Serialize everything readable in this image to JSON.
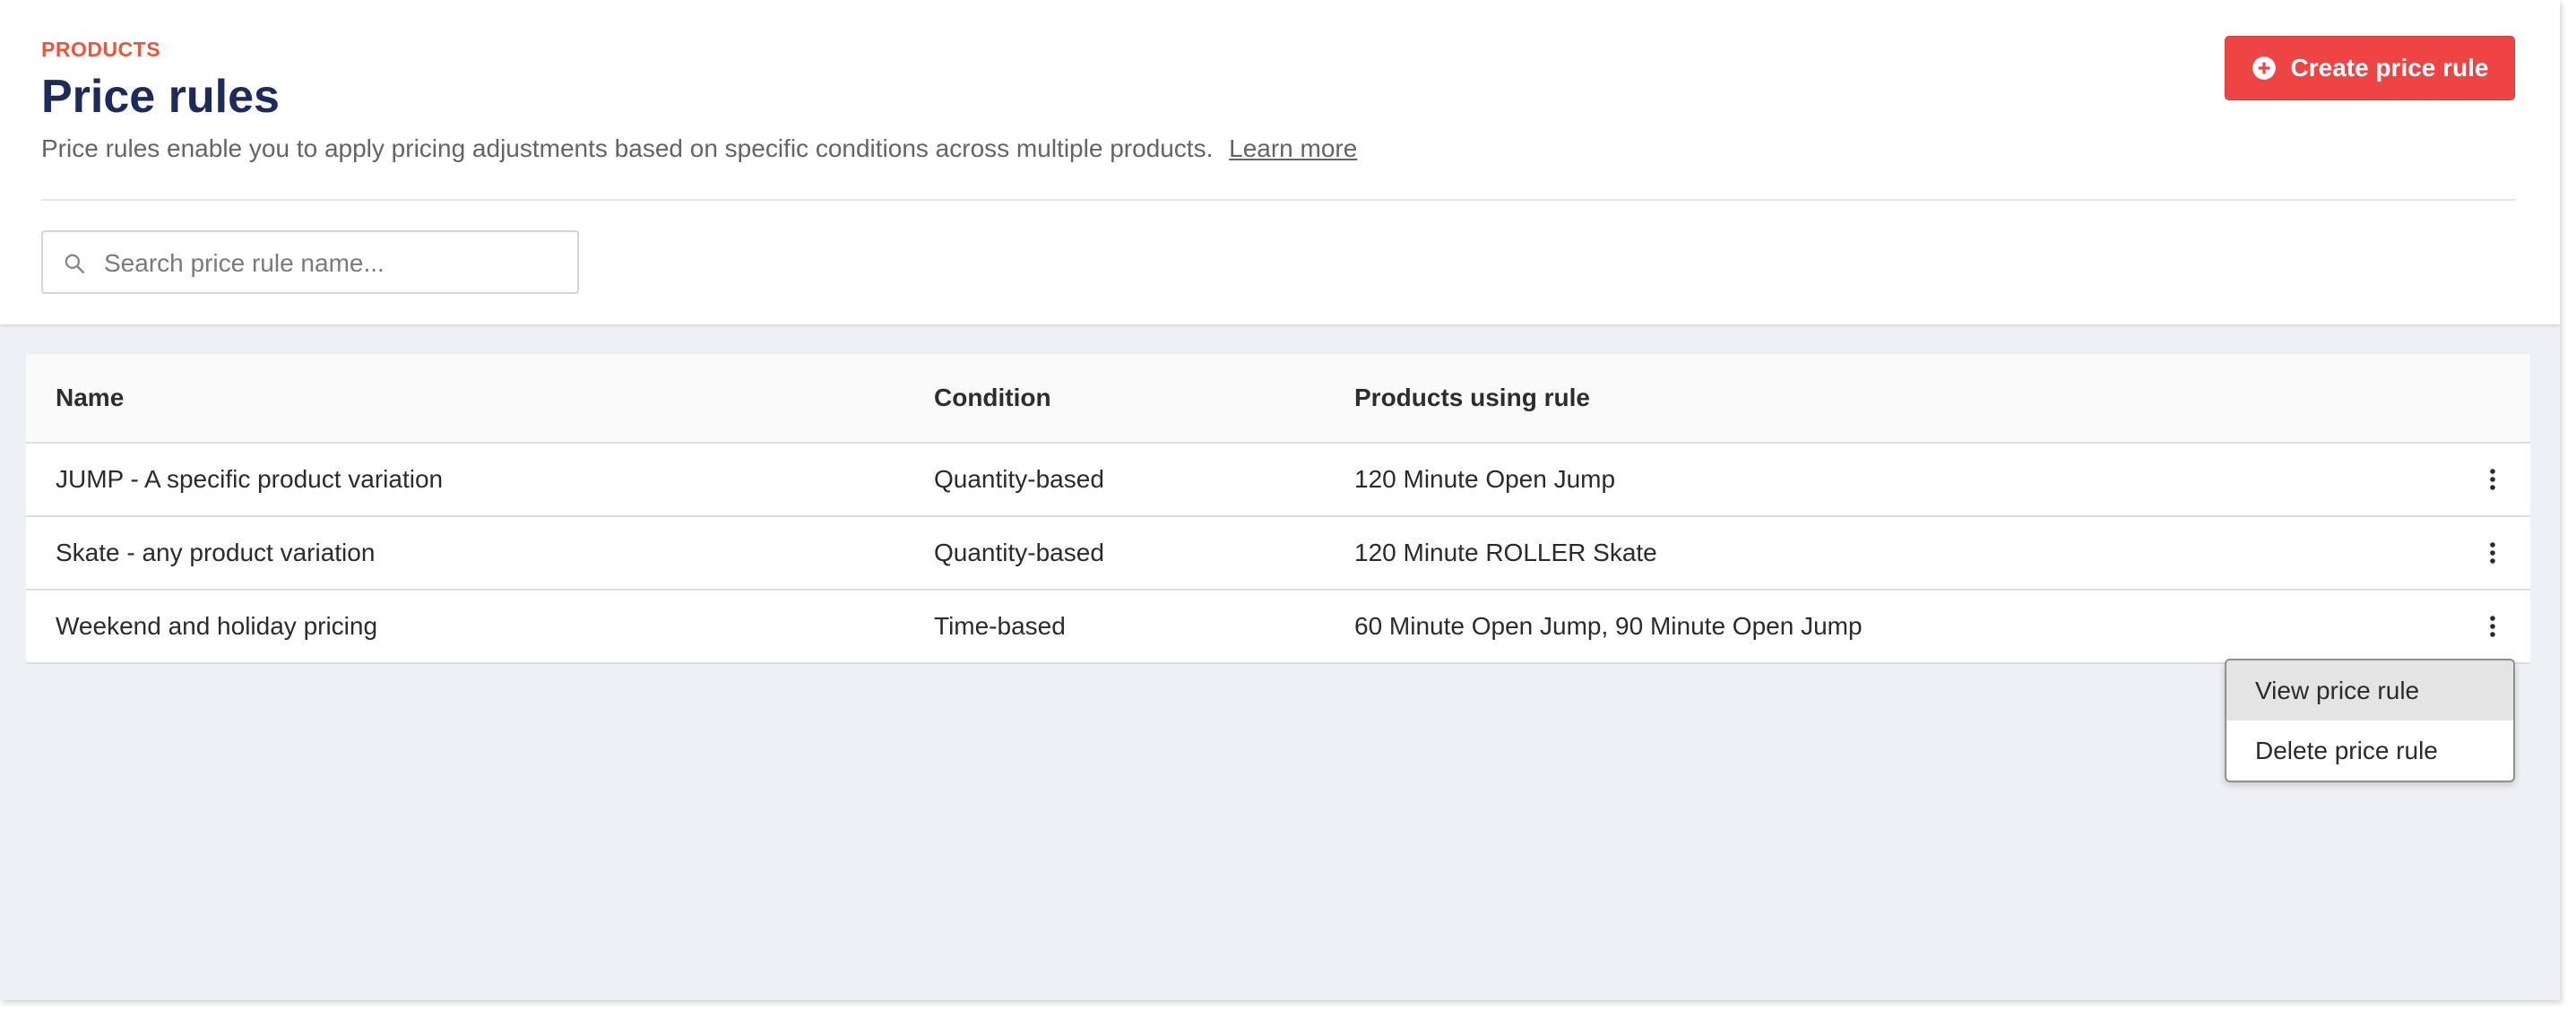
{
  "header": {
    "eyebrow": "PRODUCTS",
    "title": "Price rules",
    "subtitle": "Price rules enable you to apply pricing adjustments based on specific conditions across multiple products.",
    "learn_more": "Learn more",
    "create_button_label": "Create price rule",
    "create_button_icon": "plus-circle-icon"
  },
  "search": {
    "placeholder": "Search price rule name...",
    "value": "",
    "icon": "search-icon"
  },
  "table": {
    "columns": [
      "Name",
      "Condition",
      "Products using rule"
    ],
    "rows": [
      {
        "name": "JUMP - A specific product variation",
        "condition": "Quantity-based",
        "products": "120 Minute Open Jump"
      },
      {
        "name": "Skate - any product variation",
        "condition": "Quantity-based",
        "products": "120 Minute ROLLER Skate"
      },
      {
        "name": "Weekend and holiday pricing",
        "condition": "Time-based",
        "products": "60 Minute Open Jump, 90 Minute Open Jump"
      }
    ],
    "row_action_icon": "more-vertical-icon"
  },
  "context_menu": {
    "items": [
      "View price rule",
      "Delete price rule"
    ],
    "highlighted": "View price rule"
  },
  "colors": {
    "accent": "#ef4444",
    "eyebrow": "#f0533b",
    "title": "#1c2b5a",
    "background": "#eef0f5"
  }
}
